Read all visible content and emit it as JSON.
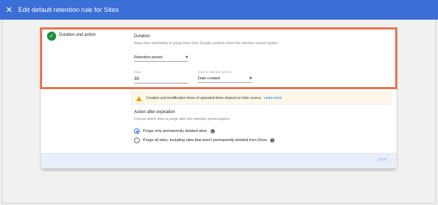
{
  "header": {
    "close_icon": "close-icon",
    "title": "Edit default retention rule for Sites"
  },
  "step": {
    "label": "Duration and action",
    "status_icon": "check-icon",
    "status_color": "#1e8e3e"
  },
  "duration": {
    "title": "Duration",
    "description": "Keep sites indefinitely or purge them from Google systems when the retention period expires",
    "mode_select": {
      "value": "Retention period"
    },
    "days": {
      "label": "Days",
      "value": "30"
    },
    "start": {
      "label": "Start of retention period",
      "value": "Date created"
    }
  },
  "notice": {
    "text": "Creation and modification times of uploaded items depend on their source.",
    "link": "Learn more"
  },
  "action": {
    "title": "Action after expiration",
    "description": "Choose which sites to purge after the retention period expires",
    "options": [
      {
        "label": "Purge only permanently deleted sites",
        "selected": true
      },
      {
        "label": "Purge all sites, including sites that aren't permanently deleted from Drive",
        "selected": false
      }
    ]
  },
  "footer": {
    "save_label": "SAVE"
  },
  "colors": {
    "accent": "#3b6fd6",
    "highlight": "#e8734a",
    "link": "#1a73e8"
  }
}
